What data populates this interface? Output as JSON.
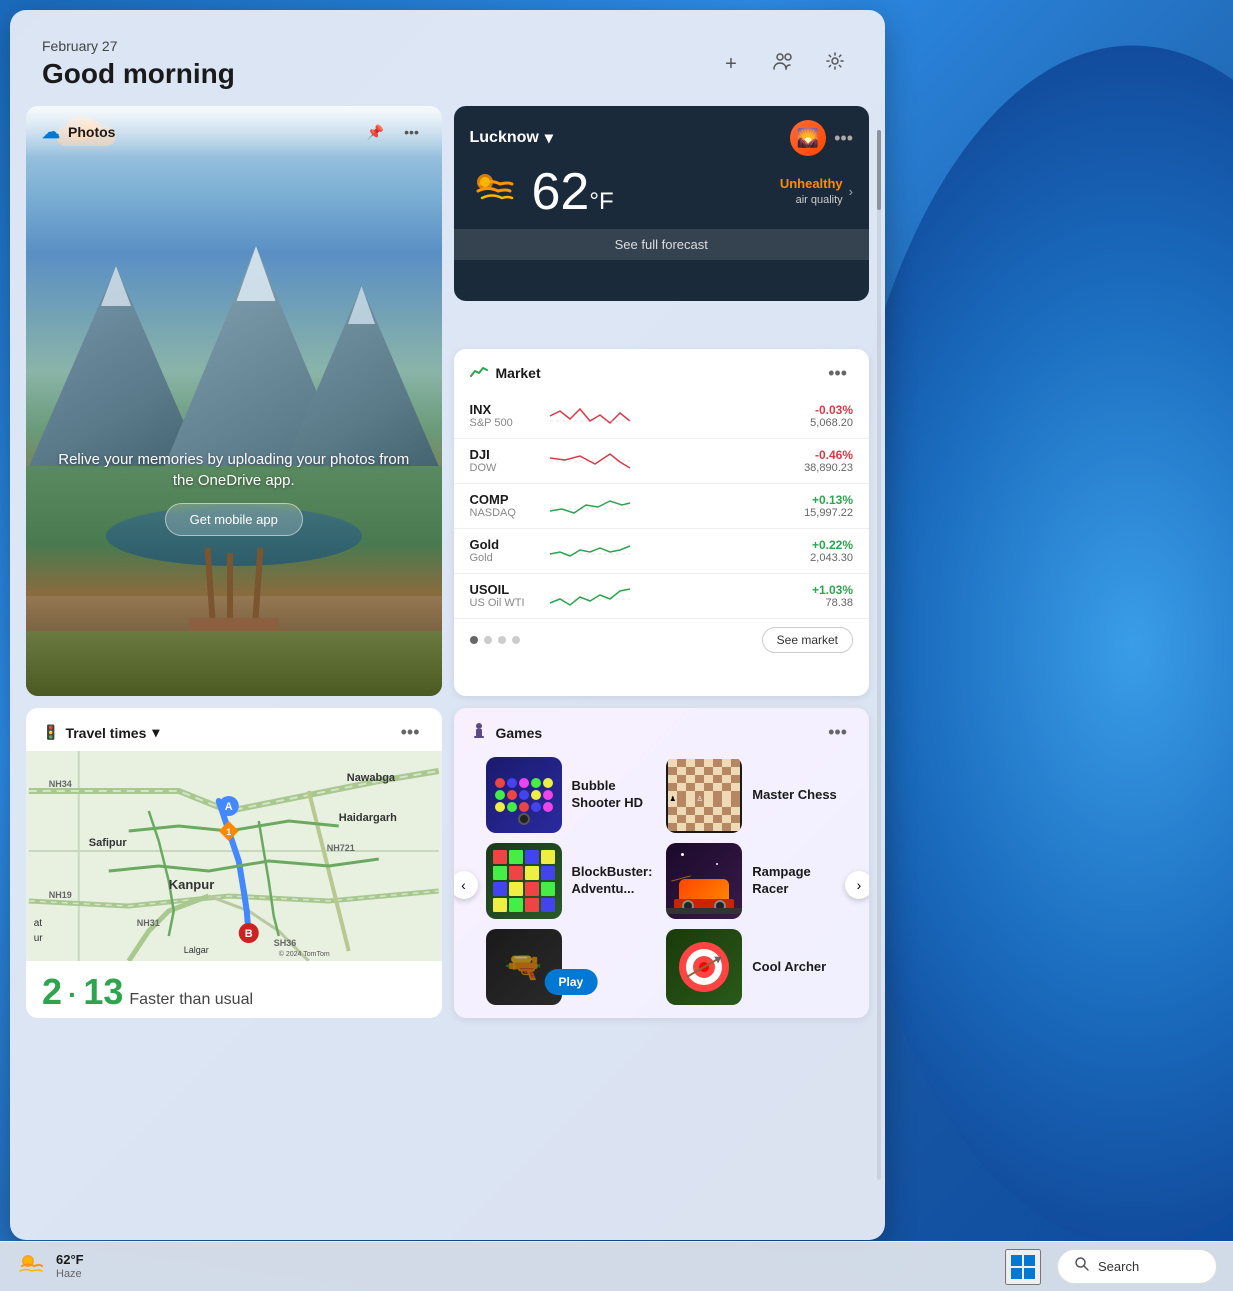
{
  "header": {
    "date": "February 27",
    "greeting": "Good morning",
    "add_label": "+",
    "profile_label": "👥",
    "settings_label": "⚙"
  },
  "photos_widget": {
    "title": "Photos",
    "pin_icon": "📌",
    "more_icon": "...",
    "overlay_text": "Relive your memories by uploading your photos from the OneDrive app.",
    "get_app_button": "Get mobile app",
    "cloud_icon": "☁"
  },
  "weather_widget": {
    "location": "Lucknow",
    "chevron": "▾",
    "more": "...",
    "temp": "62",
    "unit": "°F",
    "icon": "🌬",
    "aqi_label": "Unhealthy",
    "aqi_sublabel": "air quality",
    "forecast_button": "See full forecast"
  },
  "market_widget": {
    "title": "Market",
    "icon": "📈",
    "more": "...",
    "stocks": [
      {
        "symbol": "INX",
        "name": "S&P 500",
        "change": "-0.03%",
        "value": "5,068.20",
        "direction": "down"
      },
      {
        "symbol": "DJI",
        "name": "DOW",
        "change": "-0.46%",
        "value": "38,890.23",
        "direction": "down"
      },
      {
        "symbol": "COMP",
        "name": "NASDAQ",
        "change": "+0.13%",
        "value": "15,997.22",
        "direction": "up"
      },
      {
        "symbol": "Gold",
        "name": "Gold",
        "change": "+0.22%",
        "value": "2,043.30",
        "direction": "up"
      },
      {
        "symbol": "USOIL",
        "name": "US Oil WTI",
        "change": "+1.03%",
        "value": "78.38",
        "direction": "up"
      }
    ],
    "see_market_button": "See market",
    "dots": 4
  },
  "travel_widget": {
    "title": "Travel times",
    "chevron": "▾",
    "more": "...",
    "travel_time": "2 · 13",
    "status": "Faster than usual",
    "map_labels": [
      "Nawabga",
      "Safipur",
      "Kanpur",
      "Haidargarh",
      "at",
      "ur",
      "Lalgar",
      "NH34",
      "NH19",
      "NH31",
      "NH721",
      "SH36",
      "© 2024 TomTom"
    ]
  },
  "games_widget": {
    "title": "Games",
    "icon": "♟",
    "more": "...",
    "play_button": "Play",
    "games": [
      {
        "name": "Bubble Shooter HD",
        "color": "#1a1a6e"
      },
      {
        "name": "Master Chess",
        "color": "#2a2a2a"
      },
      {
        "name": "BlockBuster: Adventu...",
        "color": "#1a3a1a"
      },
      {
        "name": "Rampage Racer",
        "color": "#1a0a2a"
      },
      {
        "name": "Play",
        "color": "#1a1a1a"
      },
      {
        "name": "Cool Archer",
        "color": "#1a3a0a"
      }
    ]
  },
  "taskbar": {
    "temp": "62°F",
    "condition": "Haze",
    "weather_icon": "🌬",
    "search_text": "Search"
  }
}
